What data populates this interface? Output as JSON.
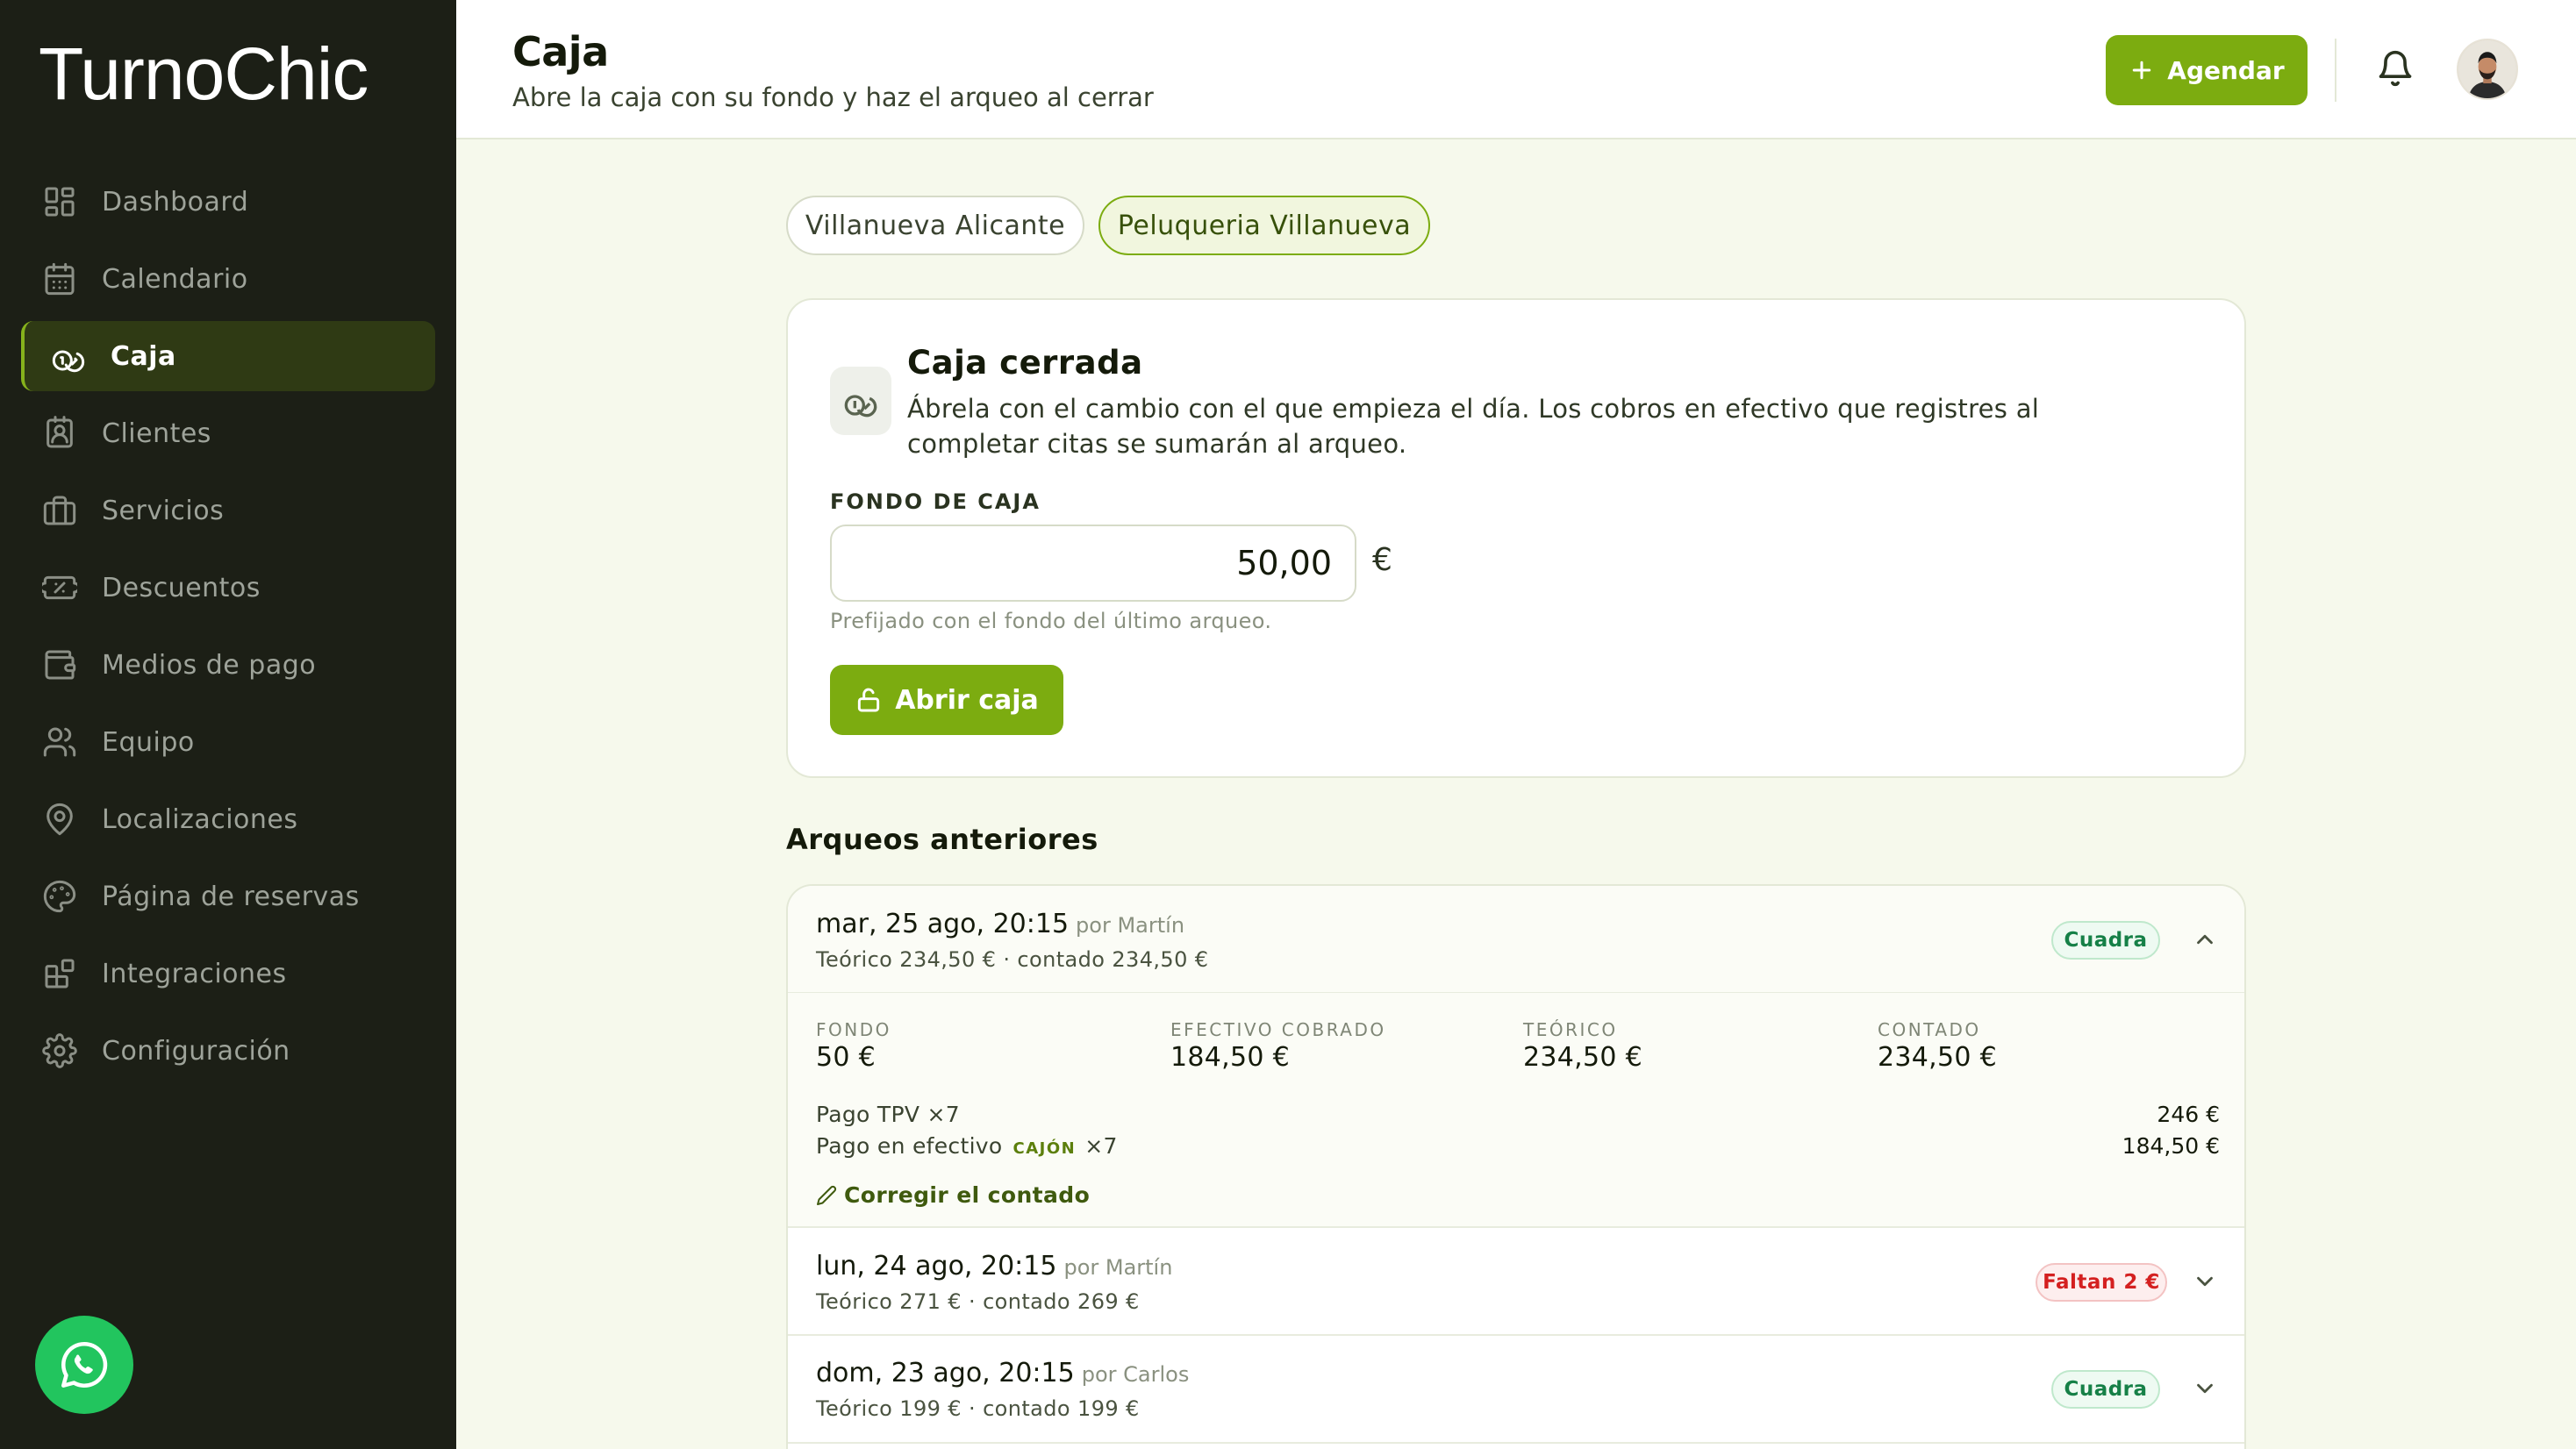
{
  "app": {
    "logo_text": "TurnoChic"
  },
  "sidebar": {
    "items": [
      {
        "label": "Dashboard",
        "icon": "dashboard-icon"
      },
      {
        "label": "Calendario",
        "icon": "calendar-icon"
      },
      {
        "label": "Caja",
        "icon": "coins-icon",
        "active": true
      },
      {
        "label": "Clientes",
        "icon": "contact-card-icon"
      },
      {
        "label": "Servicios",
        "icon": "briefcase-icon"
      },
      {
        "label": "Descuentos",
        "icon": "ticket-icon"
      },
      {
        "label": "Medios de pago",
        "icon": "wallet-icon"
      },
      {
        "label": "Equipo",
        "icon": "users-icon"
      },
      {
        "label": "Localizaciones",
        "icon": "map-pin-icon"
      },
      {
        "label": "Página de reservas",
        "icon": "palette-icon"
      },
      {
        "label": "Integraciones",
        "icon": "blocks-icon"
      },
      {
        "label": "Configuración",
        "icon": "gear-icon"
      }
    ],
    "whatsapp_icon": "whatsapp-icon"
  },
  "header": {
    "title": "Caja",
    "subtitle": "Abre la caja con su fondo y haz el arqueo al cerrar",
    "agendar_label": "Agendar"
  },
  "locations": [
    "Villanueva Alicante",
    "Peluqueria Villanueva"
  ],
  "selected_location": "Peluqueria Villanueva",
  "caja": {
    "title": "Caja cerrada",
    "description": "Ábrela con el cambio con el que empieza el día. Los cobros en efectivo que registres al completar citas se sumarán al arqueo.",
    "fondo_label": "FONDO DE CAJA",
    "fondo_value": "50,00",
    "currency": "€",
    "hint": "Prefijado con el fondo del último arqueo.",
    "open_label": "Abrir caja"
  },
  "arqueos": {
    "title": "Arqueos anteriores",
    "items": [
      {
        "date": "mar, 25 ago, 20:15",
        "by": "por Martín",
        "summary": "Teórico 234,50 € · contado 234,50 €",
        "status": "Cuadra",
        "status_type": "ok",
        "expanded": true,
        "details": {
          "stats": [
            {
              "label": "FONDO",
              "value": "50 €"
            },
            {
              "label": "EFECTIVO COBRADO",
              "value": "184,50 €"
            },
            {
              "label": "TEÓRICO",
              "value": "234,50 €"
            },
            {
              "label": "CONTADO",
              "value": "234,50 €"
            }
          ],
          "payments": [
            {
              "label": "Pago TPV",
              "count": "×7",
              "tag": "",
              "amount": "246 €"
            },
            {
              "label": "Pago en efectivo",
              "count": "×7",
              "tag": "CAJÓN",
              "amount": "184,50 €"
            }
          ],
          "correct_label": "Corregir el contado"
        }
      },
      {
        "date": "lun, 24 ago, 20:15",
        "by": "por Martín",
        "summary": "Teórico 271 € · contado 269 €",
        "status": "Faltan 2 €",
        "status_type": "bad",
        "expanded": false
      },
      {
        "date": "dom, 23 ago, 20:15",
        "by": "por Carlos",
        "summary": "Teórico 199 € · contado 199 €",
        "status": "Cuadra",
        "status_type": "ok",
        "expanded": false
      }
    ]
  },
  "colors": {
    "accent": "#7cac10",
    "sidebar_bg": "#1c1f16",
    "page_bg": "#f6f9ec",
    "ok": "#168047",
    "bad": "#d42020"
  }
}
